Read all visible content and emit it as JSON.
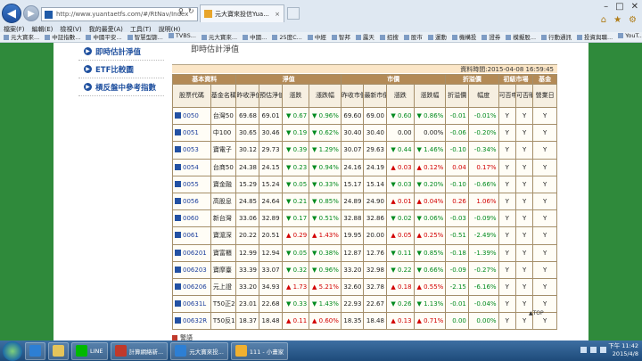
{
  "browser": {
    "url": "http://www.yuantaetfs.com/#/RtNav/Index",
    "tab_title": "元大寶來投信Yua...",
    "menu": [
      "檔案(F)",
      "編輯(E)",
      "檢視(V)",
      "我的最愛(A)",
      "工具(T)",
      "說明(H)"
    ],
    "favorites": [
      "元大寶來...",
      "中証指數...",
      "中國平安...",
      "智慧型篩...",
      "TVBS...",
      "元大寶來...",
      "中國...",
      "25度C...",
      "中經",
      "智邦",
      "露天",
      "招搜",
      "股市",
      "運動",
      "機構投",
      "證券",
      "模擬股...",
      "行動通訊",
      "投資與職...",
      "YouT...",
      "搜尋",
      "桂林總..."
    ]
  },
  "sidebar": {
    "items": [
      {
        "label": "即時估計淨值"
      },
      {
        "label": "ETF比較圖"
      },
      {
        "label": "槓反盤中參考指數"
      }
    ]
  },
  "page": {
    "title": "即時估計淨值",
    "timestamp": "資料時間:2015-04-08 16:59:45",
    "top_link": "▲TOP",
    "warning": "警語"
  },
  "table": {
    "groups": [
      "基本資料",
      "淨值",
      "市價",
      "折溢價",
      "初級市場",
      "基金"
    ],
    "headers": [
      "股票代碼",
      "基金名稱",
      "昨收淨值",
      "預估淨值",
      "漲跌",
      "漲跌幅",
      "昨收市價",
      "最新市價",
      "漲跌",
      "漲跌幅",
      "折溢價",
      "幅度",
      "可否申購",
      "可否贖回",
      "營業日"
    ],
    "rows": [
      {
        "code": "0050",
        "name": "台灣50",
        "nav_prev": "69.68",
        "nav_est": "69.01",
        "nav_chg": "▼ 0.67",
        "nav_pct": "▼ 0.96%",
        "nav_dir": "up",
        "mkt_prev": "69.60",
        "mkt_last": "69.00",
        "mkt_chg": "▼ 0.60",
        "mkt_pct": "▼ 0.86%",
        "mkt_dir": "up",
        "prem": "-0.01",
        "prem_pct": "-0.01%",
        "prem_dir": "up",
        "sub": "Y",
        "red": "Y",
        "biz": "Y"
      },
      {
        "code": "0051",
        "name": "中100",
        "nav_prev": "30.65",
        "nav_est": "30.46",
        "nav_chg": "▼ 0.19",
        "nav_pct": "▼ 0.62%",
        "nav_dir": "up",
        "mkt_prev": "30.40",
        "mkt_last": "30.40",
        "mkt_chg": "0.00",
        "mkt_pct": "0.00%",
        "mkt_dir": "flat",
        "prem": "-0.06",
        "prem_pct": "-0.20%",
        "prem_dir": "up",
        "sub": "Y",
        "red": "Y",
        "biz": "Y"
      },
      {
        "code": "0053",
        "name": "寶電子",
        "nav_prev": "30.12",
        "nav_est": "29.73",
        "nav_chg": "▼ 0.39",
        "nav_pct": "▼ 1.29%",
        "nav_dir": "up",
        "mkt_prev": "30.07",
        "mkt_last": "29.63",
        "mkt_chg": "▼ 0.44",
        "mkt_pct": "▼ 1.46%",
        "mkt_dir": "up",
        "prem": "-0.10",
        "prem_pct": "-0.34%",
        "prem_dir": "up",
        "sub": "Y",
        "red": "Y",
        "biz": "Y"
      },
      {
        "code": "0054",
        "name": "台商50",
        "nav_prev": "24.38",
        "nav_est": "24.15",
        "nav_chg": "▼ 0.23",
        "nav_pct": "▼ 0.94%",
        "nav_dir": "up",
        "mkt_prev": "24.16",
        "mkt_last": "24.19",
        "mkt_chg": "▲ 0.03",
        "mkt_pct": "▲ 0.12%",
        "mkt_dir": "dn",
        "prem": "0.04",
        "prem_pct": "0.17%",
        "prem_dir": "dn",
        "sub": "Y",
        "red": "Y",
        "biz": "Y"
      },
      {
        "code": "0055",
        "name": "寶金融",
        "nav_prev": "15.29",
        "nav_est": "15.24",
        "nav_chg": "▼ 0.05",
        "nav_pct": "▼ 0.33%",
        "nav_dir": "up",
        "mkt_prev": "15.17",
        "mkt_last": "15.14",
        "mkt_chg": "▼ 0.03",
        "mkt_pct": "▼ 0.20%",
        "mkt_dir": "up",
        "prem": "-0.10",
        "prem_pct": "-0.66%",
        "prem_dir": "up",
        "sub": "Y",
        "red": "Y",
        "biz": "Y"
      },
      {
        "code": "0056",
        "name": "高股息",
        "nav_prev": "24.85",
        "nav_est": "24.64",
        "nav_chg": "▼ 0.21",
        "nav_pct": "▼ 0.85%",
        "nav_dir": "up",
        "mkt_prev": "24.89",
        "mkt_last": "24.90",
        "mkt_chg": "▲ 0.01",
        "mkt_pct": "▲ 0.04%",
        "mkt_dir": "dn",
        "prem": "0.26",
        "prem_pct": "1.06%",
        "prem_dir": "dn",
        "sub": "Y",
        "red": "Y",
        "biz": "Y"
      },
      {
        "code": "0060",
        "name": "新台灣",
        "nav_prev": "33.06",
        "nav_est": "32.89",
        "nav_chg": "▼ 0.17",
        "nav_pct": "▼ 0.51%",
        "nav_dir": "up",
        "mkt_prev": "32.88",
        "mkt_last": "32.86",
        "mkt_chg": "▼ 0.02",
        "mkt_pct": "▼ 0.06%",
        "mkt_dir": "up",
        "prem": "-0.03",
        "prem_pct": "-0.09%",
        "prem_dir": "up",
        "sub": "Y",
        "red": "Y",
        "biz": "Y"
      },
      {
        "code": "0061",
        "name": "寶滬深",
        "nav_prev": "20.22",
        "nav_est": "20.51",
        "nav_chg": "▲ 0.29",
        "nav_pct": "▲ 1.43%",
        "nav_dir": "dn",
        "mkt_prev": "19.95",
        "mkt_last": "20.00",
        "mkt_chg": "▲ 0.05",
        "mkt_pct": "▲ 0.25%",
        "mkt_dir": "dn",
        "prem": "-0.51",
        "prem_pct": "-2.49%",
        "prem_dir": "up",
        "sub": "Y",
        "red": "Y",
        "biz": "Y"
      },
      {
        "code": "006201",
        "name": "寶富櫃",
        "nav_prev": "12.99",
        "nav_est": "12.94",
        "nav_chg": "▼ 0.05",
        "nav_pct": "▼ 0.38%",
        "nav_dir": "up",
        "mkt_prev": "12.87",
        "mkt_last": "12.76",
        "mkt_chg": "▼ 0.11",
        "mkt_pct": "▼ 0.85%",
        "mkt_dir": "up",
        "prem": "-0.18",
        "prem_pct": "-1.39%",
        "prem_dir": "up",
        "sub": "Y",
        "red": "Y",
        "biz": "Y"
      },
      {
        "code": "006203",
        "name": "寶摩臺",
        "nav_prev": "33.39",
        "nav_est": "33.07",
        "nav_chg": "▼ 0.32",
        "nav_pct": "▼ 0.96%",
        "nav_dir": "up",
        "mkt_prev": "33.20",
        "mkt_last": "32.98",
        "mkt_chg": "▼ 0.22",
        "mkt_pct": "▼ 0.66%",
        "mkt_dir": "up",
        "prem": "-0.09",
        "prem_pct": "-0.27%",
        "prem_dir": "up",
        "sub": "Y",
        "red": "Y",
        "biz": "Y"
      },
      {
        "code": "006206",
        "name": "元上證",
        "nav_prev": "33.20",
        "nav_est": "34.93",
        "nav_chg": "▲ 1.73",
        "nav_pct": "▲ 5.21%",
        "nav_dir": "dn",
        "mkt_prev": "32.60",
        "mkt_last": "32.78",
        "mkt_chg": "▲ 0.18",
        "mkt_pct": "▲ 0.55%",
        "mkt_dir": "dn",
        "prem": "-2.15",
        "prem_pct": "-6.16%",
        "prem_dir": "up",
        "sub": "Y",
        "red": "Y",
        "biz": "Y"
      },
      {
        "code": "00631L",
        "name": "T50正2",
        "nav_prev": "23.01",
        "nav_est": "22.68",
        "nav_chg": "▼ 0.33",
        "nav_pct": "▼ 1.43%",
        "nav_dir": "up",
        "mkt_prev": "22.93",
        "mkt_last": "22.67",
        "mkt_chg": "▼ 0.26",
        "mkt_pct": "▼ 1.13%",
        "mkt_dir": "up",
        "prem": "-0.01",
        "prem_pct": "-0.04%",
        "prem_dir": "up",
        "sub": "Y",
        "red": "Y",
        "biz": "Y"
      },
      {
        "code": "00632R",
        "name": "T50反1",
        "nav_prev": "18.37",
        "nav_est": "18.48",
        "nav_chg": "▲ 0.11",
        "nav_pct": "▲ 0.60%",
        "nav_dir": "dn",
        "mkt_prev": "18.35",
        "mkt_last": "18.48",
        "mkt_chg": "▲ 0.13",
        "mkt_pct": "▲ 0.71%",
        "mkt_dir": "dn",
        "prem": "0.00",
        "prem_pct": "0.00%",
        "prem_dir": "up",
        "sub": "Y",
        "red": "Y",
        "biz": "Y"
      }
    ]
  },
  "taskbar": {
    "apps": [
      "LINE",
      "計算網絡新...",
      "元大寶來投...",
      "111 - 小畫家"
    ],
    "time": "下午 11:42",
    "date": "2015/4/8"
  },
  "colors": {
    "up_green": "#008a1e",
    "down_red": "#d20000",
    "header_brown": "#b38a56"
  }
}
